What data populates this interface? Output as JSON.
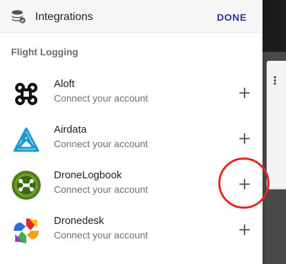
{
  "header": {
    "title": "Integrations",
    "done_label": "DONE",
    "icon": "stack-icon"
  },
  "section": {
    "title": "Flight Logging"
  },
  "integrations": [
    {
      "name": "Aloft",
      "subtitle": "Connect your account",
      "logo": "aloft-logo",
      "action": "+"
    },
    {
      "name": "Airdata",
      "subtitle": "Connect your account",
      "logo": "airdata-logo",
      "action": "+"
    },
    {
      "name": "DroneLogbook",
      "subtitle": "Connect your account",
      "logo": "dronelogbook-logo",
      "action": "+"
    },
    {
      "name": "Dronedesk",
      "subtitle": "Connect your account",
      "logo": "dronedesk-logo",
      "action": "+"
    }
  ],
  "highlight": {
    "target": "DroneLogbook add button",
    "color": "#e8231d"
  },
  "colors": {
    "accent": "#2e3192",
    "airdata": "#1f9bd1",
    "dronelogbook": "#4f7d1e"
  }
}
